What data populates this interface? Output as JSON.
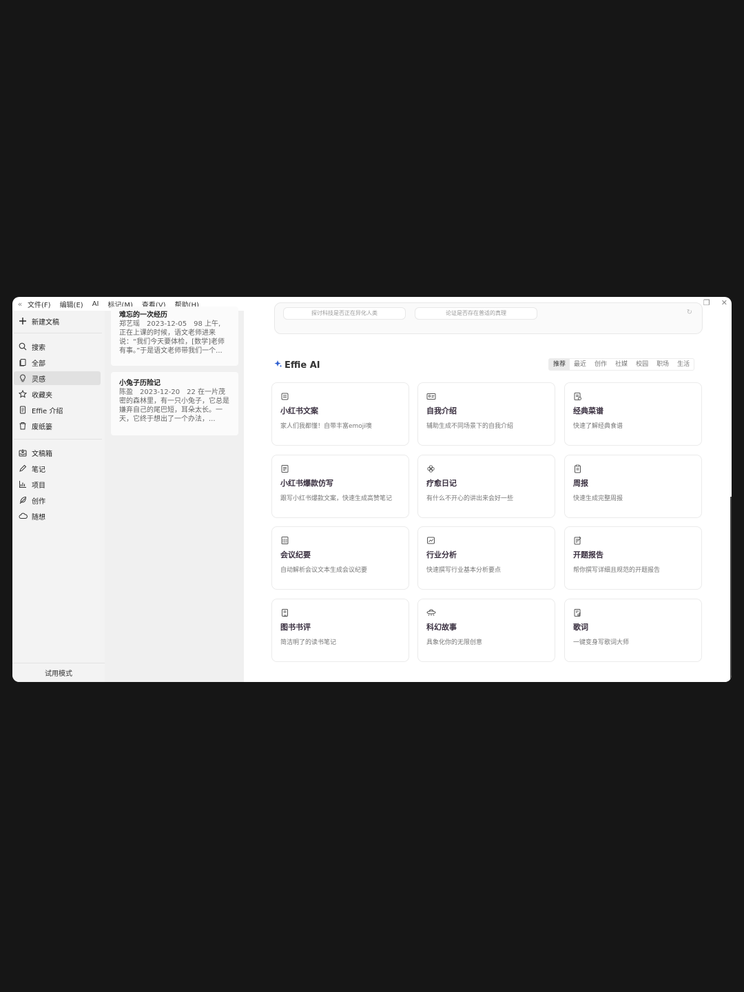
{
  "menubar": {
    "items": [
      "文件(F)",
      "编辑(E)",
      "AI",
      "标记(M)",
      "查看(V)",
      "帮助(H)"
    ],
    "collapse_icon": "double-chevron-left-icon"
  },
  "sidebar": {
    "new_doc": "新建文稿",
    "group1": [
      {
        "label": "搜索",
        "icon": "search-icon"
      },
      {
        "label": "全部",
        "icon": "copy-icon"
      },
      {
        "label": "灵感",
        "icon": "bulb-icon",
        "active": true
      },
      {
        "label": "收藏夹",
        "icon": "star-icon"
      },
      {
        "label": "Effie 介绍",
        "icon": "doc-icon"
      },
      {
        "label": "废纸篓",
        "icon": "trash-icon"
      }
    ],
    "group2": [
      {
        "label": "文稿箱",
        "icon": "inbox-icon"
      },
      {
        "label": "笔记",
        "icon": "pen-icon"
      },
      {
        "label": "项目",
        "icon": "chart-icon"
      },
      {
        "label": "创作",
        "icon": "feather-icon"
      },
      {
        "label": "随想",
        "icon": "cloud-icon"
      }
    ],
    "trial": "试用模式"
  },
  "docs": [
    {
      "title": "难忘的一次经历",
      "meta": "郑艺瑶　2023-12-05　98 上午,",
      "excerpt": "正在上课的时候，语文老师进来说：“我们今天要体检，[数学]老师有事。”于是语文老师带我们一个..."
    },
    {
      "title": "小兔子历险记",
      "meta": "陈盈　2023-12-20　22 在一片茂",
      "excerpt": "密的森林里，有一只小兔子，它总是嫌弃自己的尾巴短，耳朵太长。一天，它终于想出了一个办法，..."
    }
  ],
  "top_panel": {
    "chips": [
      "探讨科技是否正在异化人类",
      "论证是否存在普适的真理"
    ]
  },
  "effie": {
    "title": "Effie AI",
    "tabs": [
      "推荐",
      "最近",
      "创作",
      "社媒",
      "校园",
      "职场",
      "生活"
    ],
    "active_tab": "推荐"
  },
  "cards": [
    {
      "title": "小红书文案",
      "desc": "家人们我都懂！自带丰富emoji噢",
      "icon": "notebook-icon"
    },
    {
      "title": "自我介绍",
      "desc": "辅助生成不同场景下的自我介绍",
      "icon": "id-card-icon"
    },
    {
      "title": "经典菜谱",
      "desc": "快速了解经典食谱",
      "icon": "recipe-icon"
    },
    {
      "title": "小红书爆款仿写",
      "desc": "跟写小红书爆款文案，快速生成高赞笔记",
      "icon": "copy-writing-icon"
    },
    {
      "title": "疗愈日记",
      "desc": "有什么不开心的讲出来会好一些",
      "icon": "flower-icon"
    },
    {
      "title": "周报",
      "desc": "快速生成完整周报",
      "icon": "clipboard-icon"
    },
    {
      "title": "会议纪要",
      "desc": "自动解析会议文本生成会议纪要",
      "icon": "meeting-icon"
    },
    {
      "title": "行业分析",
      "desc": "快速撰写行业基本分析要点",
      "icon": "trend-icon"
    },
    {
      "title": "开题报告",
      "desc": "帮你撰写详细且规范的开题报告",
      "icon": "report-icon"
    },
    {
      "title": "图书书评",
      "desc": "简洁明了的读书笔记",
      "icon": "book-icon"
    },
    {
      "title": "科幻故事",
      "desc": "具象化你的无限创意",
      "icon": "ufo-icon"
    },
    {
      "title": "歌词",
      "desc": "一键变身写歌词大师",
      "icon": "music-doc-icon"
    }
  ]
}
